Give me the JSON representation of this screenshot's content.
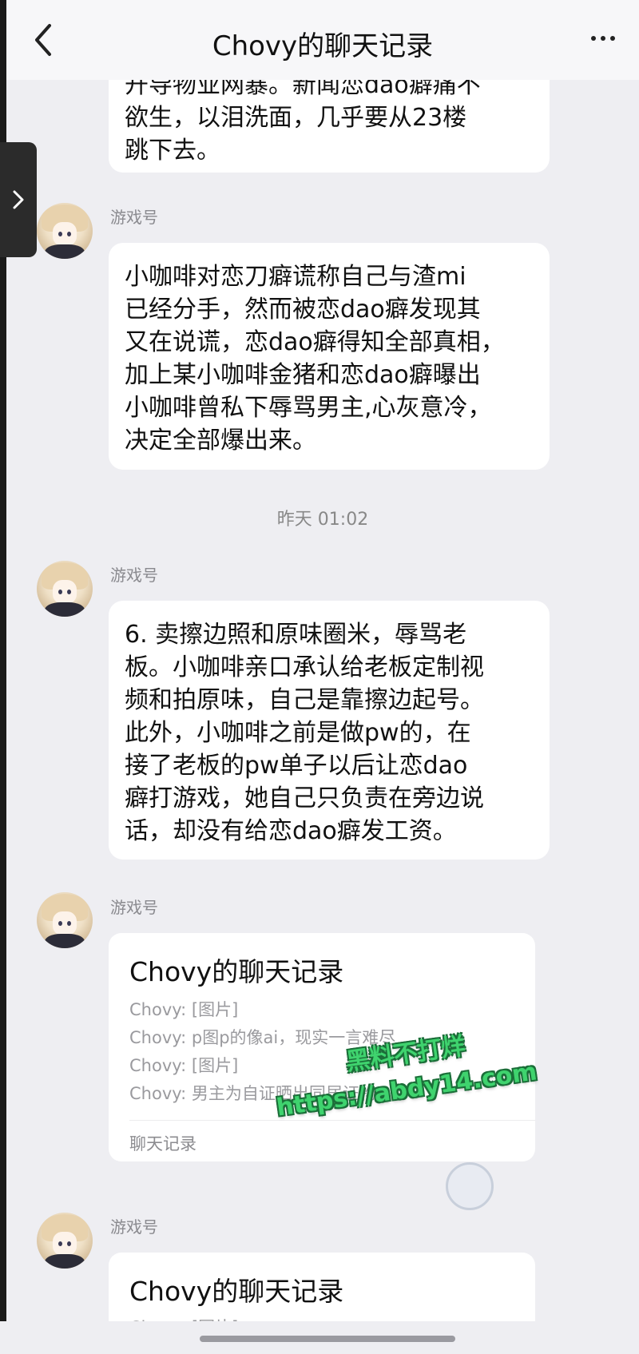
{
  "header": {
    "title": "Chovy的聊天记录",
    "back_icon": "chevron-left-icon",
    "more_icon": "more-horizontal-icon"
  },
  "messages": [
    {
      "text": "开导物业网暴。新闻恋dao癖痛不\n欲生，以泪洗面，几乎要从23楼\n跳下去。"
    },
    {
      "sender": "游戏号",
      "text": "小咖啡对恋刀癖谎称自己与渣mi\n已经分手，然而被恋dao癖发现其\n又在说谎，恋dao癖得知全部真相，\n加上某小咖啡金猪和恋dao癖曝出\n小咖啡曾私下辱骂男主,心灰意冷，\n决定全部爆出来。"
    },
    {
      "timestamp": "昨天 01:02"
    },
    {
      "sender": "游戏号",
      "text": "6. 卖擦边照和原味圈米，辱骂老\n板。小咖啡亲口承认给老板定制视\n频和拍原味，自己是靠擦边起号。\n此外，小咖啡之前是做pw的，在\n接了老板的pw单子以后让恋dao\n癖打游戏，她自己只负责在旁边说\n话，却没有给恋dao癖发工资。"
    },
    {
      "sender": "游戏号",
      "card": {
        "title": "Chovy的聊天记录",
        "lines": [
          "Chovy: [图片]",
          "Chovy: p图p的像ai，现实一言难尽",
          "Chovy: [图片]",
          "Chovy: 男主为自证晒出同居证物"
        ],
        "footer": "聊天记录"
      }
    },
    {
      "sender": "游戏号",
      "card": {
        "title": "Chovy的聊天记录",
        "lines": [
          "Chovy: [图片]"
        ]
      }
    }
  ],
  "watermark": {
    "line1": "黑料不打烊",
    "line2": "https://abdy14.com"
  },
  "colors": {
    "background": "#eeeef2",
    "bubble": "#ffffff",
    "watermark": "#3fd36e"
  }
}
